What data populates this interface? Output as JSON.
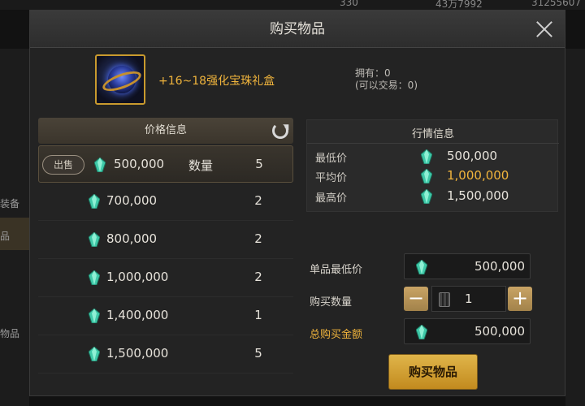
{
  "background": {
    "resources": [
      "330",
      "43万7992",
      "31255607"
    ],
    "left_items": [
      "装备",
      "品",
      "物品"
    ]
  },
  "dialog": {
    "title": "购买物品",
    "item": {
      "name": "+16~18强化宝珠礼盒",
      "owned": "拥有：0",
      "tradable": "(可以交易：0)"
    },
    "price_panel": {
      "title": "价格信息",
      "sell_label": "出售",
      "quantity_label": "数量",
      "rows": [
        {
          "price": "500,000",
          "count": "5"
        },
        {
          "price": "700,000",
          "count": "2"
        },
        {
          "price": "800,000",
          "count": "2"
        },
        {
          "price": "1,000,000",
          "count": "2"
        },
        {
          "price": "1,400,000",
          "count": "1"
        },
        {
          "price": "1,500,000",
          "count": "5"
        }
      ]
    },
    "market": {
      "title": "行情信息",
      "rows": [
        {
          "label": "最低价",
          "value": "500,000"
        },
        {
          "label": "平均价",
          "value": "1,000,000"
        },
        {
          "label": "最高价",
          "value": "1,500,000"
        }
      ]
    },
    "form": {
      "unit_min_label": "单品最低价",
      "unit_min_value": "500,000",
      "quantity_label": "购买数量",
      "quantity_value": "1",
      "minus": "−",
      "plus": "+",
      "total_label": "总购买金额",
      "total_value": "500,000"
    },
    "buy_button": "购买物品"
  },
  "colors": {
    "accent_gold": "#f0b43c",
    "gem_teal": "#3fc9a8",
    "button_gold": "#d9a534"
  }
}
